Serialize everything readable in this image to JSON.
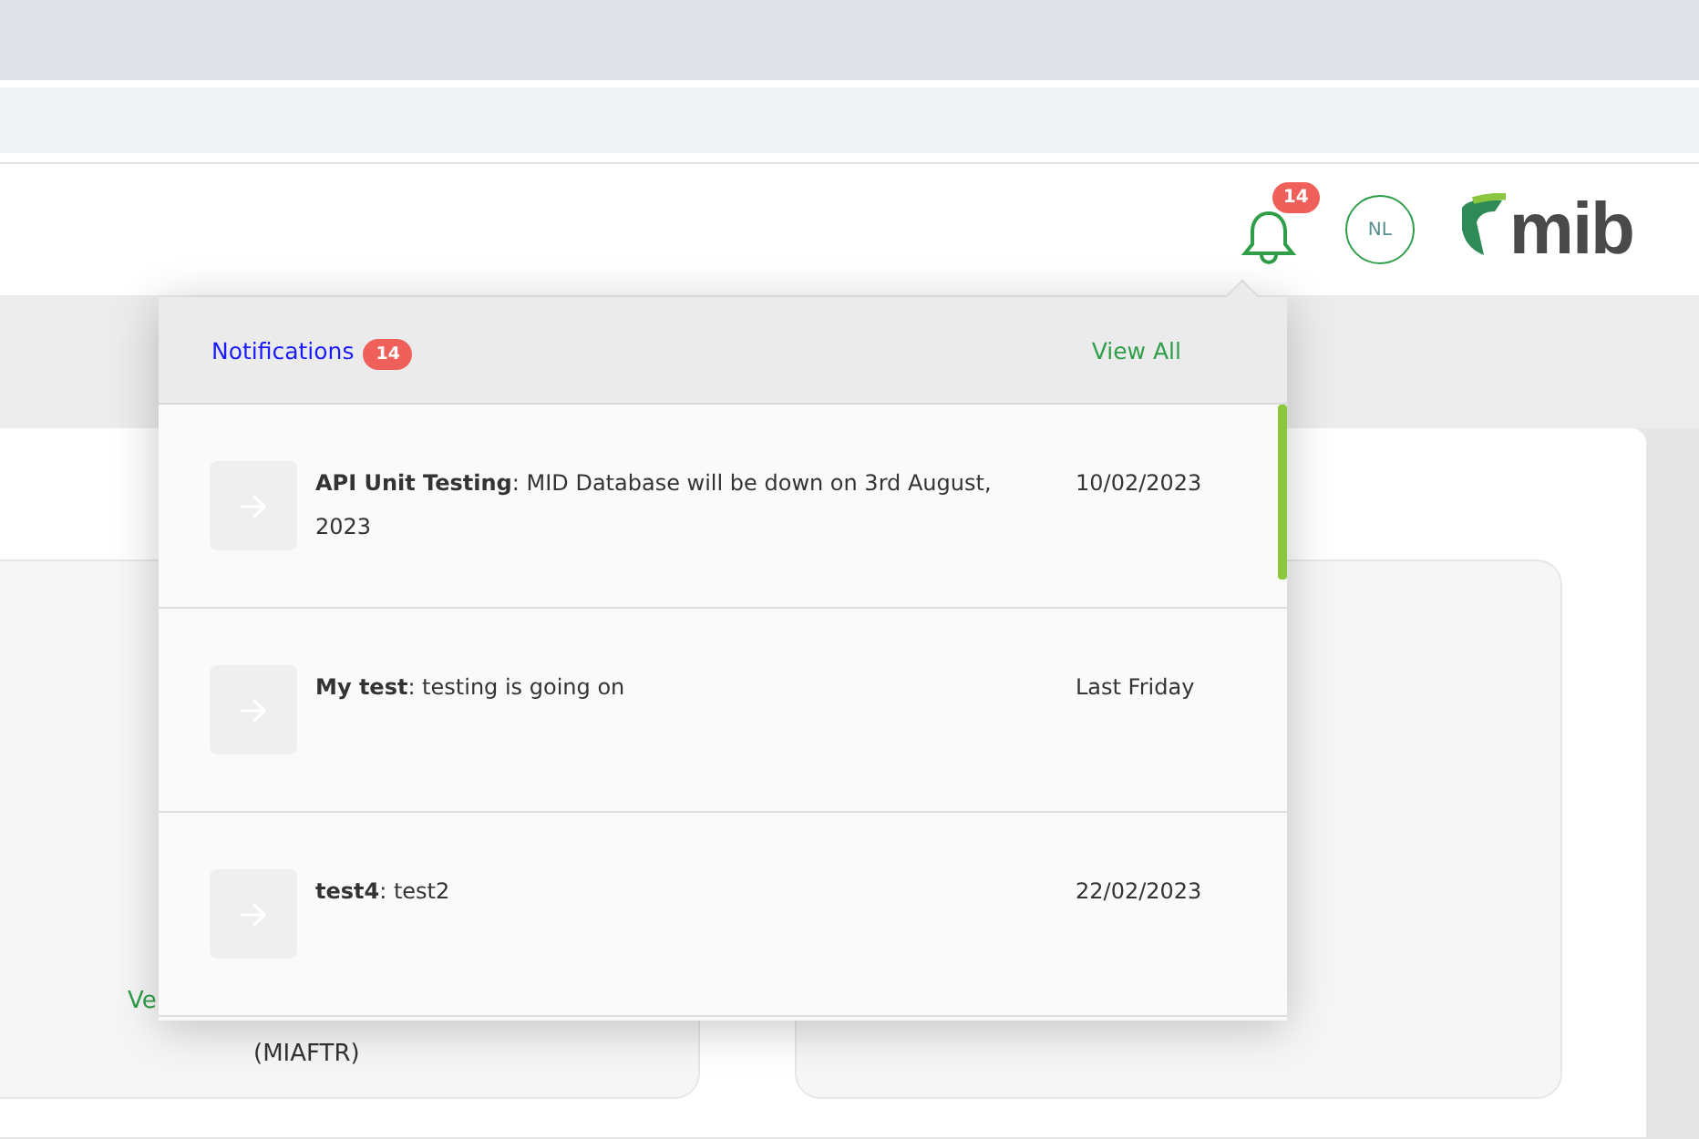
{
  "header": {
    "notification_count": "14",
    "avatar_initials": "NL",
    "logo_text": "mib"
  },
  "left_card": {
    "link": "Ve",
    "caption": "(MIAFTR)"
  },
  "notifications_panel": {
    "title": "Notifications",
    "count": "14",
    "view_all": "View All",
    "items": [
      {
        "message": "**API Unit Testing**: MID Database will be down on 3rd August, 2023",
        "date": "10/02/2023"
      },
      {
        "message": "**My test**: testing is going on",
        "date": "Last Friday"
      },
      {
        "message": "**test4**: test2",
        "date": "22/02/2023"
      }
    ]
  }
}
